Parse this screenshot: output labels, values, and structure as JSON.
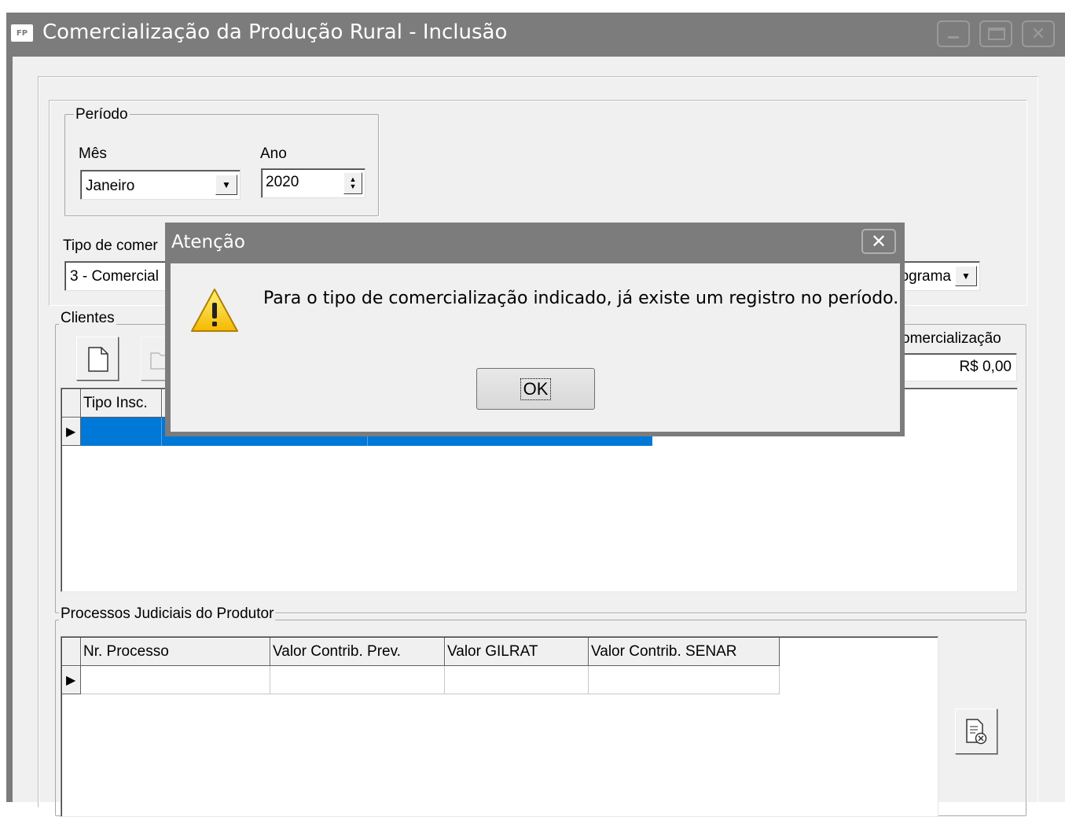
{
  "window": {
    "title": "Comercialização da Produção Rural - Inclusão",
    "logo": "FP"
  },
  "periodo": {
    "legend": "Período",
    "mes_label": "Mês",
    "mes_value": "Janeiro",
    "ano_label": "Ano",
    "ano_value": "2020"
  },
  "tipo": {
    "label": "Tipo de comer",
    "value": "3 - Comercial",
    "right_value": "ograma"
  },
  "clientes": {
    "legend": "Clientes",
    "total_label": "omercialização",
    "total_value": "R$ 0,00",
    "columns": [
      "Tipo Insc."
    ]
  },
  "processos": {
    "legend": "Processos Judiciais do Produtor",
    "columns": [
      "Nr. Processo",
      "Valor Contrib. Prev.",
      "Valor GILRAT",
      "Valor Contrib. SENAR"
    ]
  },
  "dialog": {
    "title": "Atenção",
    "message": "Para o tipo de comercialização indicado, já existe um registro no período.",
    "ok_label": "OK",
    "close_glyph": "✕"
  },
  "colors": {
    "selection": "#0078d7",
    "titlebar": "#7c7c7c",
    "warning": "#f5c400"
  }
}
